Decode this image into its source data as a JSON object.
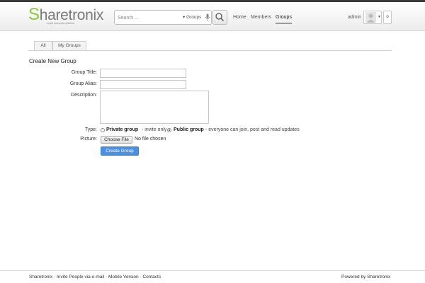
{
  "header": {
    "logo": {
      "initial": "S",
      "rest": "haretronix",
      "tagline": "social enterprise platform"
    },
    "search": {
      "placeholder": "Search ...",
      "scope": "▾ Groups"
    },
    "nav": [
      "Home",
      "Members",
      "Groups"
    ],
    "user": {
      "name": "admin",
      "menu_btn": "o"
    }
  },
  "tabs": [
    "All",
    "My Groups"
  ],
  "form": {
    "title": "Create New Group",
    "group_title_label": "Group Title:",
    "group_alias_label": "Group Alias:",
    "description_label": "Description:",
    "type_label": "Type:",
    "private_option": "Private group",
    "private_desc": "- invite only",
    "public_option": "Public group",
    "public_desc": "- everyone can join, post and read updates",
    "selected_type": "public",
    "picture_label": "Picture:",
    "choose_file": "Choose File",
    "no_file": "No file chosen",
    "submit": "Create Group"
  },
  "footer": {
    "links": [
      "Sharetronix",
      "Invite People via e-mail",
      "Mobile Version",
      "Contacts"
    ],
    "powered": "Powered by Sharetronix"
  },
  "colors": {
    "accent": "#8cc63f",
    "button_blue": "#4a90e2"
  }
}
